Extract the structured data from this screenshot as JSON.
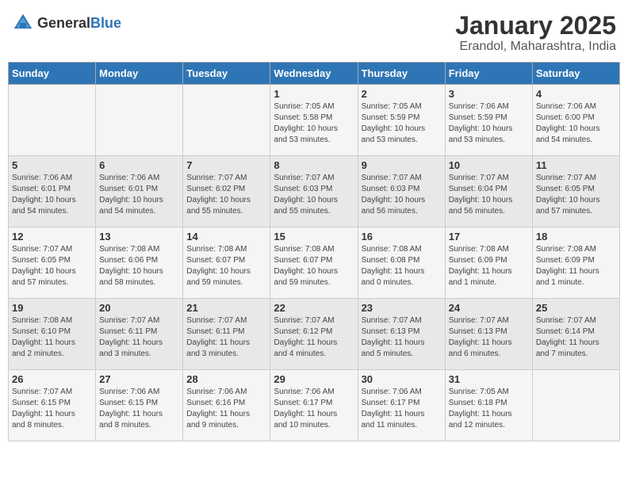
{
  "header": {
    "logo_general": "General",
    "logo_blue": "Blue",
    "title": "January 2025",
    "subtitle": "Erandol, Maharashtra, India"
  },
  "weekdays": [
    "Sunday",
    "Monday",
    "Tuesday",
    "Wednesday",
    "Thursday",
    "Friday",
    "Saturday"
  ],
  "weeks": [
    [
      {
        "day": "",
        "info": ""
      },
      {
        "day": "",
        "info": ""
      },
      {
        "day": "",
        "info": ""
      },
      {
        "day": "1",
        "info": "Sunrise: 7:05 AM\nSunset: 5:58 PM\nDaylight: 10 hours\nand 53 minutes."
      },
      {
        "day": "2",
        "info": "Sunrise: 7:05 AM\nSunset: 5:59 PM\nDaylight: 10 hours\nand 53 minutes."
      },
      {
        "day": "3",
        "info": "Sunrise: 7:06 AM\nSunset: 5:59 PM\nDaylight: 10 hours\nand 53 minutes."
      },
      {
        "day": "4",
        "info": "Sunrise: 7:06 AM\nSunset: 6:00 PM\nDaylight: 10 hours\nand 54 minutes."
      }
    ],
    [
      {
        "day": "5",
        "info": "Sunrise: 7:06 AM\nSunset: 6:01 PM\nDaylight: 10 hours\nand 54 minutes."
      },
      {
        "day": "6",
        "info": "Sunrise: 7:06 AM\nSunset: 6:01 PM\nDaylight: 10 hours\nand 54 minutes."
      },
      {
        "day": "7",
        "info": "Sunrise: 7:07 AM\nSunset: 6:02 PM\nDaylight: 10 hours\nand 55 minutes."
      },
      {
        "day": "8",
        "info": "Sunrise: 7:07 AM\nSunset: 6:03 PM\nDaylight: 10 hours\nand 55 minutes."
      },
      {
        "day": "9",
        "info": "Sunrise: 7:07 AM\nSunset: 6:03 PM\nDaylight: 10 hours\nand 56 minutes."
      },
      {
        "day": "10",
        "info": "Sunrise: 7:07 AM\nSunset: 6:04 PM\nDaylight: 10 hours\nand 56 minutes."
      },
      {
        "day": "11",
        "info": "Sunrise: 7:07 AM\nSunset: 6:05 PM\nDaylight: 10 hours\nand 57 minutes."
      }
    ],
    [
      {
        "day": "12",
        "info": "Sunrise: 7:07 AM\nSunset: 6:05 PM\nDaylight: 10 hours\nand 57 minutes."
      },
      {
        "day": "13",
        "info": "Sunrise: 7:08 AM\nSunset: 6:06 PM\nDaylight: 10 hours\nand 58 minutes."
      },
      {
        "day": "14",
        "info": "Sunrise: 7:08 AM\nSunset: 6:07 PM\nDaylight: 10 hours\nand 59 minutes."
      },
      {
        "day": "15",
        "info": "Sunrise: 7:08 AM\nSunset: 6:07 PM\nDaylight: 10 hours\nand 59 minutes."
      },
      {
        "day": "16",
        "info": "Sunrise: 7:08 AM\nSunset: 6:08 PM\nDaylight: 11 hours\nand 0 minutes."
      },
      {
        "day": "17",
        "info": "Sunrise: 7:08 AM\nSunset: 6:09 PM\nDaylight: 11 hours\nand 1 minute."
      },
      {
        "day": "18",
        "info": "Sunrise: 7:08 AM\nSunset: 6:09 PM\nDaylight: 11 hours\nand 1 minute."
      }
    ],
    [
      {
        "day": "19",
        "info": "Sunrise: 7:08 AM\nSunset: 6:10 PM\nDaylight: 11 hours\nand 2 minutes."
      },
      {
        "day": "20",
        "info": "Sunrise: 7:07 AM\nSunset: 6:11 PM\nDaylight: 11 hours\nand 3 minutes."
      },
      {
        "day": "21",
        "info": "Sunrise: 7:07 AM\nSunset: 6:11 PM\nDaylight: 11 hours\nand 3 minutes."
      },
      {
        "day": "22",
        "info": "Sunrise: 7:07 AM\nSunset: 6:12 PM\nDaylight: 11 hours\nand 4 minutes."
      },
      {
        "day": "23",
        "info": "Sunrise: 7:07 AM\nSunset: 6:13 PM\nDaylight: 11 hours\nand 5 minutes."
      },
      {
        "day": "24",
        "info": "Sunrise: 7:07 AM\nSunset: 6:13 PM\nDaylight: 11 hours\nand 6 minutes."
      },
      {
        "day": "25",
        "info": "Sunrise: 7:07 AM\nSunset: 6:14 PM\nDaylight: 11 hours\nand 7 minutes."
      }
    ],
    [
      {
        "day": "26",
        "info": "Sunrise: 7:07 AM\nSunset: 6:15 PM\nDaylight: 11 hours\nand 8 minutes."
      },
      {
        "day": "27",
        "info": "Sunrise: 7:06 AM\nSunset: 6:15 PM\nDaylight: 11 hours\nand 8 minutes."
      },
      {
        "day": "28",
        "info": "Sunrise: 7:06 AM\nSunset: 6:16 PM\nDaylight: 11 hours\nand 9 minutes."
      },
      {
        "day": "29",
        "info": "Sunrise: 7:06 AM\nSunset: 6:17 PM\nDaylight: 11 hours\nand 10 minutes."
      },
      {
        "day": "30",
        "info": "Sunrise: 7:06 AM\nSunset: 6:17 PM\nDaylight: 11 hours\nand 11 minutes."
      },
      {
        "day": "31",
        "info": "Sunrise: 7:05 AM\nSunset: 6:18 PM\nDaylight: 11 hours\nand 12 minutes."
      },
      {
        "day": "",
        "info": ""
      }
    ]
  ]
}
